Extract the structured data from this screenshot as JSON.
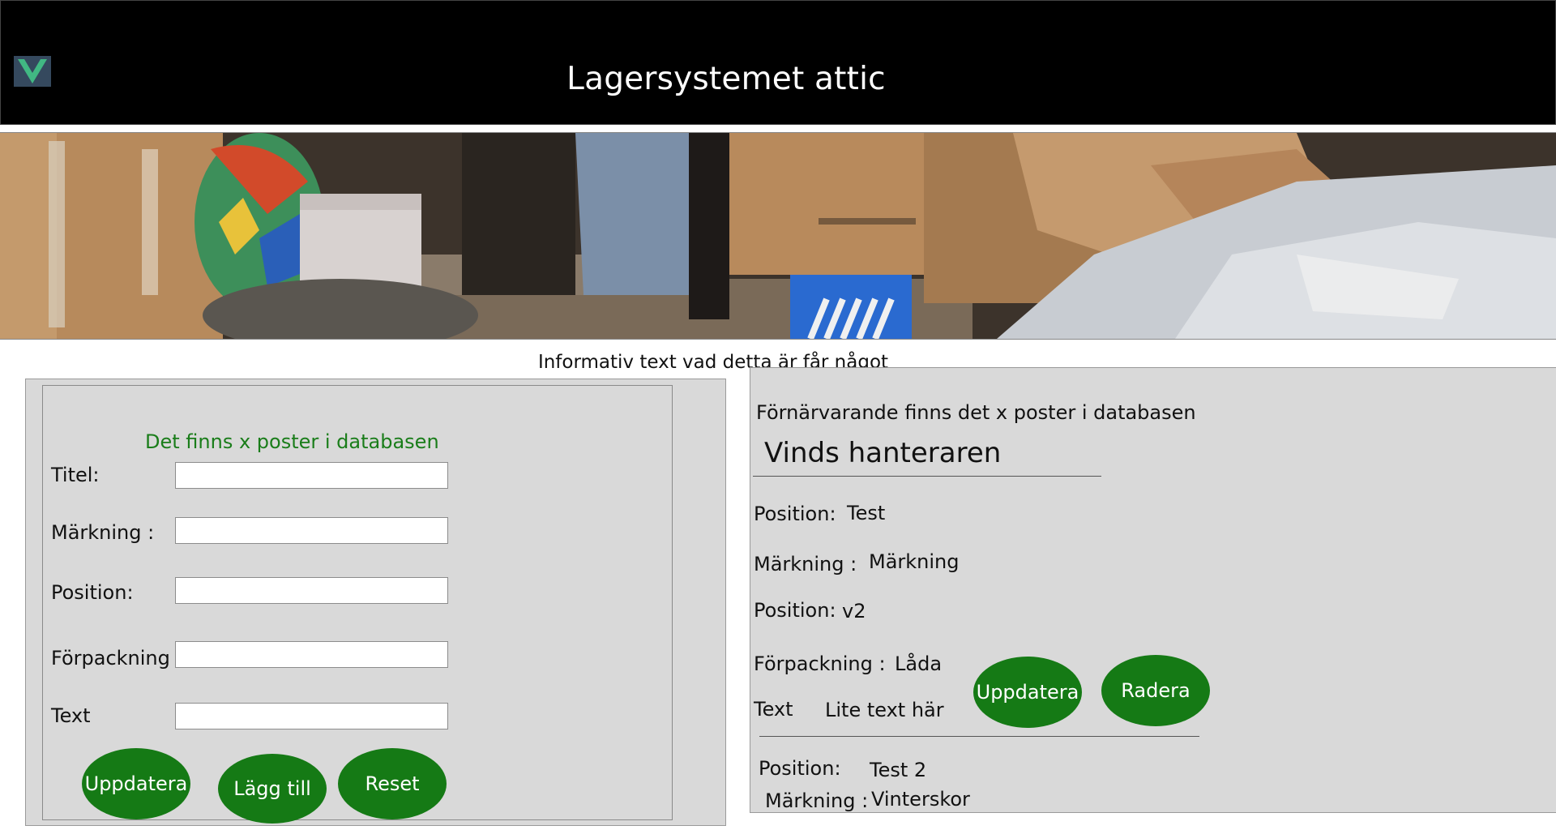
{
  "header": {
    "app_title": "Lagersystemet attic",
    "logo_icon": "vue-logo-icon"
  },
  "banner": {
    "description": ""
  },
  "info_text": "Informativ text vad detta är får något",
  "form": {
    "count_text": "Det finns x poster i databasen",
    "fields": [
      {
        "label": "Titel:",
        "value": ""
      },
      {
        "label": "Märkning :",
        "value": ""
      },
      {
        "label": "Position:",
        "value": ""
      },
      {
        "label": "Förpackning :",
        "value": ""
      },
      {
        "label": "Text",
        "value": ""
      }
    ],
    "buttons": {
      "update": "Uppdatera",
      "add": "Lägg till",
      "reset": "Reset"
    }
  },
  "listing": {
    "count_text": "Förnärvarande finns det x poster i databasen",
    "title": "Vinds hanteraren",
    "item1": {
      "position_label": "Position:",
      "position_value": "Test",
      "marking_label": "Märkning :",
      "marking_value": "Märkning",
      "position2_label": "Position:",
      "position2_value": "v2",
      "packaging_label": "Förpackning :",
      "packaging_value": "Låda",
      "text_label": "Text",
      "text_value": "Lite text här",
      "update_button": "Uppdatera",
      "delete_button": "Radera"
    },
    "item2": {
      "position_label": "Position:",
      "position_value": "Test 2",
      "marking_label": "Märkning :",
      "marking_value": "Vinterskor"
    }
  },
  "colors": {
    "header_bg": "#000000",
    "panel_bg": "#d9d9d9",
    "button_green": "#157a15",
    "count_green": "#1a7d1a"
  }
}
